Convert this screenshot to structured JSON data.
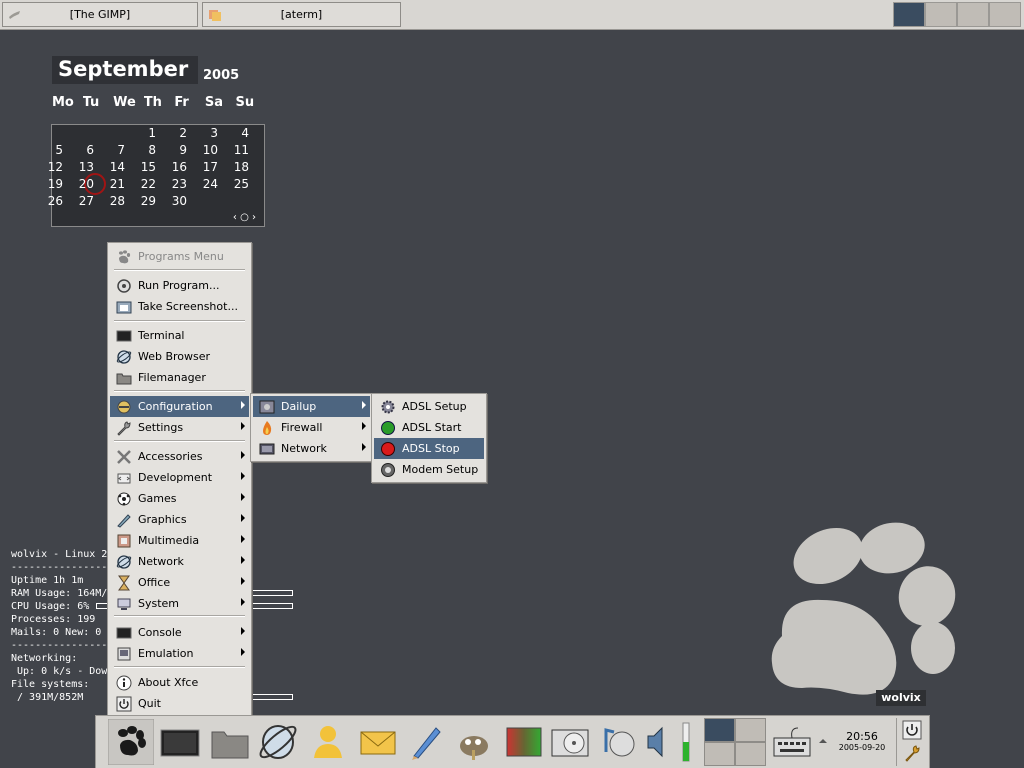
{
  "taskbar": {
    "tasks": [
      {
        "label": "[The GIMP]",
        "icon": "gimp-icon"
      },
      {
        "label": "[aterm]",
        "icon": "terminal-icon"
      }
    ],
    "workspaces": 4
  },
  "calendar": {
    "month": "September",
    "year": "2005",
    "weekdays": [
      "Mo",
      "Tu",
      "We",
      "Th",
      "Fr",
      "Sa",
      "Su"
    ],
    "today": "20",
    "nav": "‹ ○ ›"
  },
  "conky": {
    "lines": [
      "wolvix - Linux 2",
      "------------------",
      "Uptime 1h 1m",
      "RAM Usage: 164M/",
      "CPU Usage: 6%",
      "Processes: 199",
      "Mails: 0 New: 0",
      "------------------",
      "Networking:",
      " Up: 0 k/s - Dow",
      "File systems:",
      " / 391M/852M"
    ]
  },
  "menu": {
    "title": "Programs Menu",
    "items": [
      {
        "label": "Run Program...",
        "icon": "run-icon"
      },
      {
        "label": "Take Screenshot...",
        "icon": "screenshot-icon"
      },
      {
        "label": "Terminal",
        "icon": "terminal-icon"
      },
      {
        "label": "Web Browser",
        "icon": "globe-icon"
      },
      {
        "label": "Filemanager",
        "icon": "folder-icon"
      },
      {
        "label": "Configuration",
        "icon": "configuration-icon",
        "submenu": true
      },
      {
        "label": "Settings",
        "icon": "wrench-icon",
        "submenu": true
      },
      {
        "label": "Accessories",
        "icon": "tools-icon",
        "submenu": true
      },
      {
        "label": "Development",
        "icon": "development-icon",
        "submenu": true
      },
      {
        "label": "Games",
        "icon": "games-icon",
        "submenu": true
      },
      {
        "label": "Graphics",
        "icon": "graphics-icon",
        "submenu": true
      },
      {
        "label": "Multimedia",
        "icon": "film-icon",
        "submenu": true
      },
      {
        "label": "Network",
        "icon": "globe-icon",
        "submenu": true
      },
      {
        "label": "Office",
        "icon": "hourglass-icon",
        "submenu": true
      },
      {
        "label": "System",
        "icon": "system-icon",
        "submenu": true
      },
      {
        "label": "Console",
        "icon": "terminal-icon",
        "submenu": true
      },
      {
        "label": "Emulation",
        "icon": "emulation-icon",
        "submenu": true
      },
      {
        "label": "About Xfce",
        "icon": "info-icon"
      },
      {
        "label": "Quit",
        "icon": "power-icon"
      }
    ]
  },
  "configuration_menu": {
    "items": [
      {
        "label": "Dailup",
        "icon": "dialup-icon",
        "submenu": true
      },
      {
        "label": "Firewall",
        "icon": "fire-icon",
        "submenu": true
      },
      {
        "label": "Network",
        "icon": "network-icon",
        "submenu": true
      }
    ]
  },
  "dailup_menu": {
    "items": [
      {
        "label": "ADSL Setup",
        "icon": "gear-icon"
      },
      {
        "label": "ADSL Start",
        "icon": "green-dot-icon"
      },
      {
        "label": "ADSL Stop",
        "icon": "red-dot-icon"
      },
      {
        "label": "Modem Setup",
        "icon": "modem-icon"
      }
    ]
  },
  "wallpaper": {
    "brand": "wolvix"
  },
  "panel": {
    "time": "20:56",
    "date": "2005-09-20"
  },
  "colors": {
    "desktop": "#41444a",
    "menu_bg": "#e4e2de",
    "selection": "#4d6580",
    "panel_bg": "#d6d4d0",
    "today_ring": "#a01414"
  }
}
